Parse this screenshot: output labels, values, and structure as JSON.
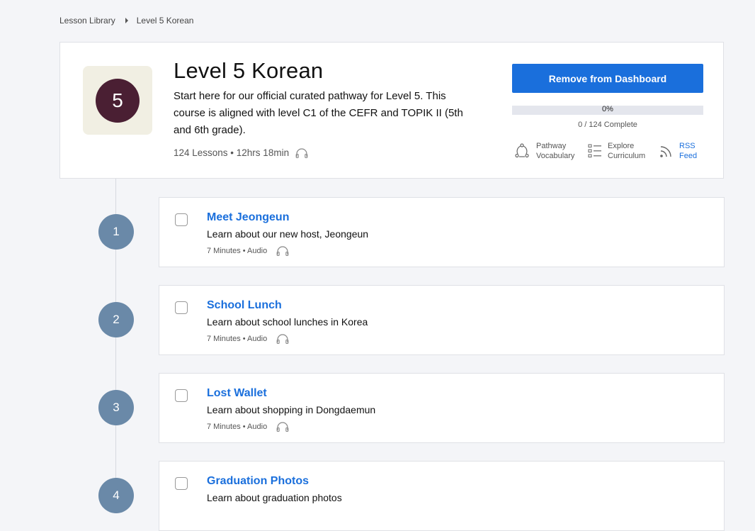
{
  "breadcrumb": {
    "root": "Lesson Library",
    "current": "Level 5 Korean"
  },
  "course": {
    "badge": "5",
    "title": "Level 5 Korean",
    "description": "Start here for our official curated pathway for Level 5. This course is aligned with level C1 of the CEFR and TOPIK II (5th and 6th grade).",
    "meta": "124 Lessons • 12hrs 18min",
    "meta_icon": "headphones-icon",
    "remove_button": "Remove from Dashboard",
    "progress": {
      "percent_label": "0%",
      "fraction": 0,
      "count_label": "0 / 124 Complete"
    },
    "actions": {
      "pathway": {
        "line1": "Pathway",
        "line2": "Vocabulary",
        "icon": "share-cycle-icon"
      },
      "explore": {
        "line1": "Explore",
        "line2": "Curriculum",
        "icon": "list-icon"
      },
      "rss": {
        "line1": "RSS",
        "line2": "Feed",
        "icon": "rss-icon"
      }
    }
  },
  "colors": {
    "accent": "#1a6fdc",
    "badge_bg": "#4a1f33",
    "step_bg": "#6a89a8"
  },
  "lessons": [
    {
      "number": "1",
      "title": "Meet Jeongeun",
      "description": "Learn about our new host, Jeongeun",
      "meta": "7 Minutes • Audio"
    },
    {
      "number": "2",
      "title": "School Lunch",
      "description": "Learn about school lunches in Korea",
      "meta": "7 Minutes • Audio"
    },
    {
      "number": "3",
      "title": "Lost Wallet",
      "description": "Learn about shopping in Dongdaemun",
      "meta": "7 Minutes • Audio"
    },
    {
      "number": "4",
      "title": "Graduation Photos",
      "description": "Learn about graduation photos",
      "meta": ""
    }
  ]
}
